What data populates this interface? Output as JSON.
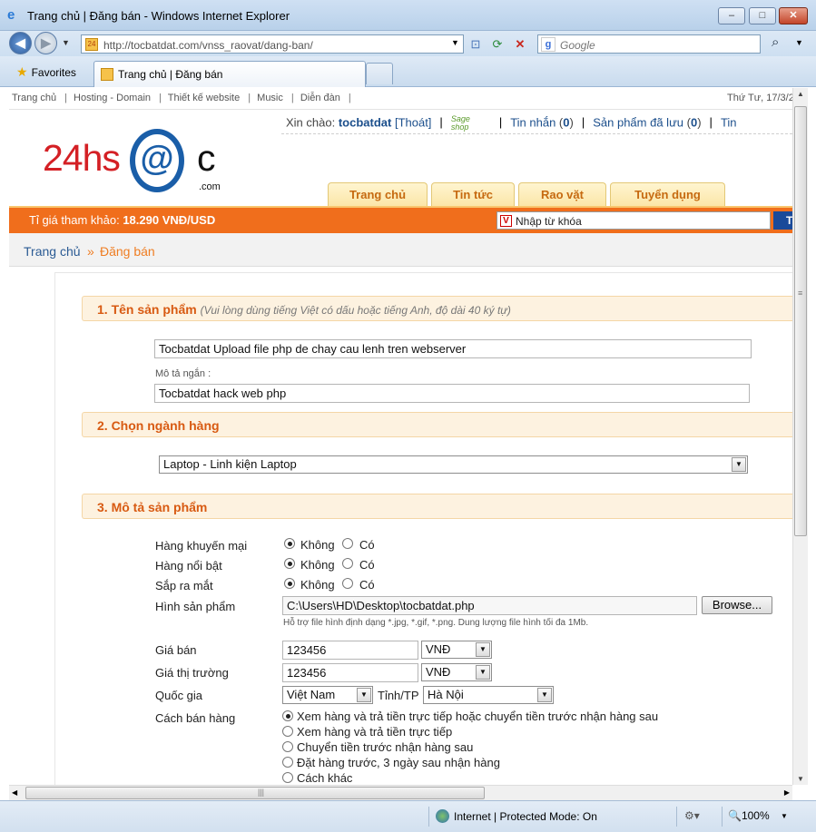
{
  "window": {
    "title": "Trang chủ | Đăng bán - Windows Internet Explorer",
    "min": "–",
    "max": "□",
    "close": "✕"
  },
  "toolbar": {
    "url": "http://tocbatdat.com/vnss_raovat/dang-ban/",
    "search_placeholder": "Google",
    "favorites": "Favorites",
    "tab_title": "Trang chủ | Đăng bán"
  },
  "status": {
    "zone": "Internet | Protected Mode: On",
    "zoom": "100%"
  },
  "page": {
    "topnav": [
      "Trang chủ",
      "Hosting - Domain",
      "Thiết kế website",
      "Music",
      "Diễn đàn"
    ],
    "date": "Thứ Tư, 17/3/2",
    "greet": {
      "prefix": "Xin chào: ",
      "user": "tocbatdat",
      "logout": "[Thoát]",
      "shop": "Sage shop",
      "messages": "Tin nhắn",
      "messages_count": "0",
      "saved": "Sản phẩm đã lưu",
      "saved_count": "0",
      "more": "Tin"
    },
    "logo": {
      "left": "24hs",
      "at": "@",
      "right": "c",
      "com": ".com"
    },
    "mainnav": [
      "Trang chủ",
      "Tin tức",
      "Rao vặt",
      "Tuyển dụng"
    ],
    "rate_label": "Tỉ giá tham khảo: ",
    "rate_value": "18.290 VNĐ/USD",
    "keyword_placeholder": "Nhập từ khóa",
    "keyword_go": "Ti",
    "breadcrumb": {
      "home": "Trang chủ",
      "sep": "»",
      "current": "Đăng bán"
    }
  },
  "form": {
    "s1_title": "1. Tên sản phẩm",
    "s1_hint": "(Vui lòng dùng tiếng Việt có dấu hoặc tiếng Anh, độ dài 40 ký tự)",
    "product_name": "Tocbatdat Upload file php de chay cau lenh tren webserver",
    "short_desc_label": "Mô tả ngắn :",
    "short_desc": "Tocbatdat hack web php",
    "s2_title": "2. Chọn ngành hàng",
    "category": "Laptop - Linh kiện Laptop",
    "s3_title": "3. Mô tả sản phẩm",
    "promo_label": "Hàng khuyến mại",
    "featured_label": "Hàng nổi bật",
    "upcoming_label": "Sắp ra mắt",
    "no": "Không",
    "yes": "Có",
    "image_label": "Hình sản phẩm",
    "image_path": "C:\\Users\\HD\\Desktop\\tocbatdat.php",
    "browse": "Browse...",
    "image_note": "Hỗ trợ file hình định dạng *.jpg, *.gif, *.png. Dung lượng file hình tối đa 1Mb.",
    "price_label": "Giá bán",
    "price": "123456",
    "market_label": "Giá thị trường",
    "market": "123456",
    "currency": "VNĐ",
    "country_label": "Quốc gia",
    "country": "Việt Nam",
    "city_label": "Tỉnh/TP",
    "city": "Hà Nội",
    "sell_label": "Cách bán hàng",
    "sell_options": [
      "Xem hàng và trả tiền trực tiếp hoặc chuyển tiền trước nhận hàng sau",
      "Xem hàng và trả tiền trực tiếp",
      "Chuyển tiền trước nhận hàng sau",
      "Đặt hàng trước, 3 ngày sau nhận hàng",
      "Cách khác"
    ]
  }
}
